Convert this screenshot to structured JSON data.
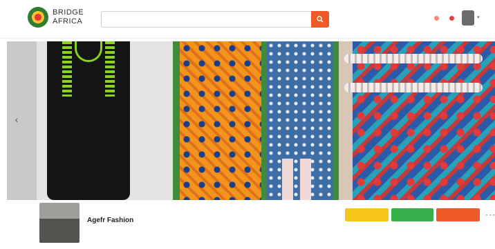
{
  "header": {
    "logo_line1": "BRIDGE",
    "logo_line2": "AFRICA",
    "search": {
      "placeholder": "",
      "value": "",
      "category": "",
      "button_icon": "search-icon"
    },
    "nav": [
      "",
      ""
    ],
    "icons": [
      "notification-icon",
      "message-icon"
    ],
    "accent_color": "#f05a28"
  },
  "carousel": {
    "slides": [
      "slide-1",
      "slide-2",
      "slide-3"
    ],
    "prev_icon": "chevron-left-icon",
    "next_icon": "chevron-right-icon",
    "prev_glyph": "‹",
    "next_glyph": "›"
  },
  "profile": {
    "name": "Agefr Fashion",
    "subtitle": "",
    "buttons": {
      "follow_label": "",
      "message_label": "",
      "call_label": "",
      "follow_color": "#f6c518",
      "message_color": "#35b04a",
      "call_color": "#f05a28"
    },
    "more_label": "···",
    "stats": [
      "",
      "",
      "",
      "",
      ""
    ]
  }
}
